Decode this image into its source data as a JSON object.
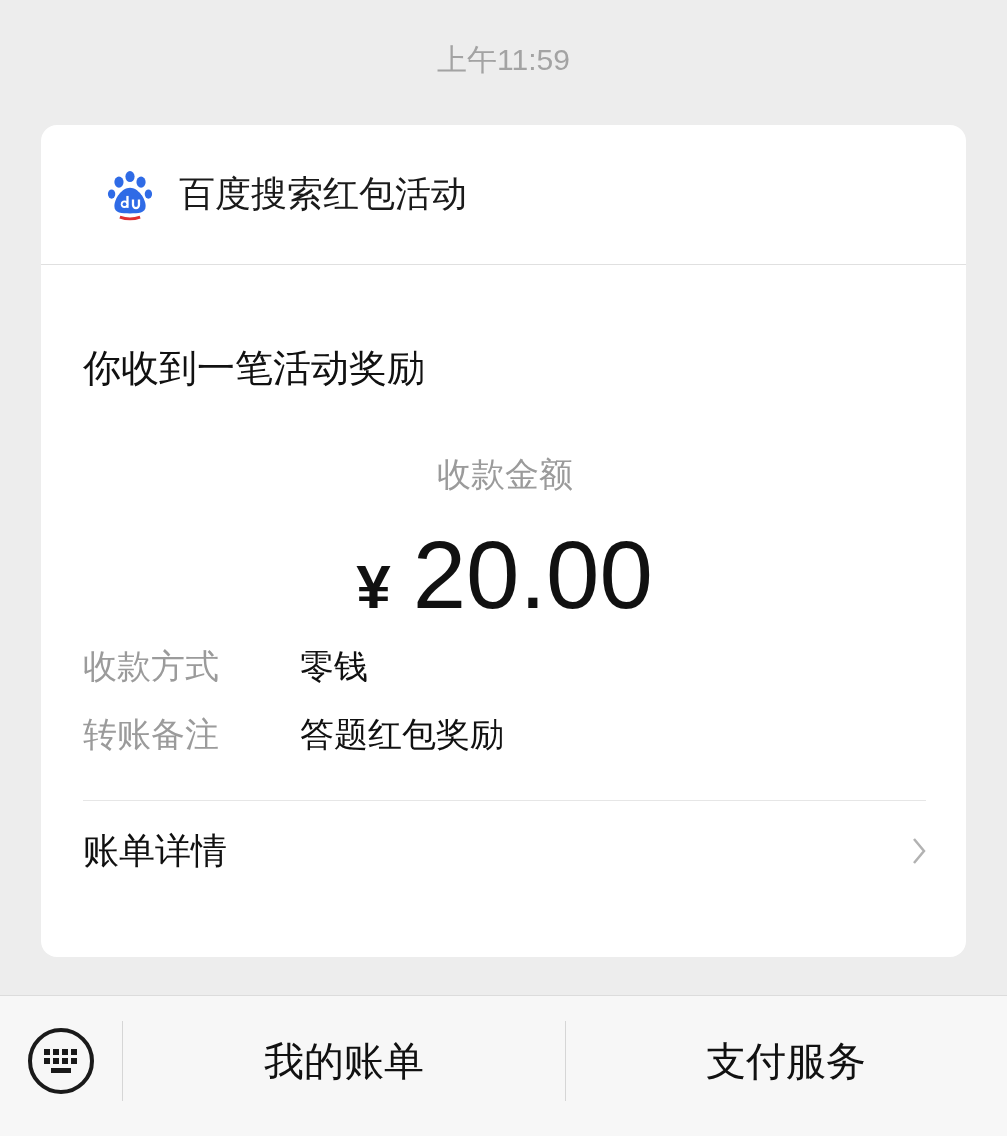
{
  "time": "上午11:59",
  "card": {
    "source": {
      "title": "百度搜索红包活动"
    },
    "heading": "你收到一笔活动奖励",
    "amount": {
      "label": "收款金额",
      "currency": "¥",
      "value": "20.00"
    },
    "details": [
      {
        "label": "收款方式",
        "value": "零钱"
      },
      {
        "label": "转账备注",
        "value": "答题红包奖励"
      }
    ],
    "bill_link": {
      "label": "账单详情"
    }
  },
  "bottom_bar": {
    "buttons": [
      "我的账单",
      "支付服务"
    ]
  }
}
